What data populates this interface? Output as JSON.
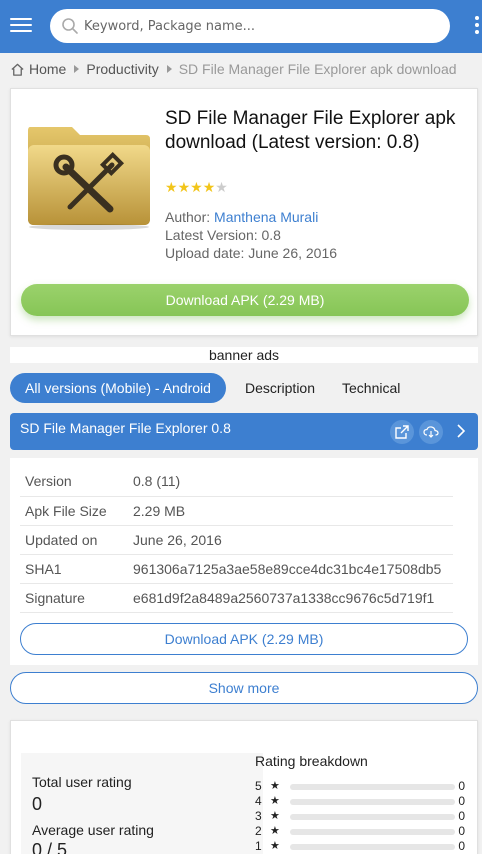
{
  "header": {
    "search_placeholder": "Keyword, Package name..."
  },
  "breadcrumb": {
    "home": "Home",
    "category": "Productivity",
    "current": "SD File Manager File Explorer apk download"
  },
  "app": {
    "title": "SD File Manager File Explorer apk download (Latest version: 0.8)",
    "rating_stars": 4,
    "max_stars": 5,
    "author_label": "Author:",
    "author_name": "Manthena Murali",
    "latest_version": "Latest Version: 0.8",
    "upload_date": "Upload date: June 26, 2016",
    "download_button": "Download APK (2.29 MB)"
  },
  "banner": "banner ads",
  "tabs": [
    {
      "label": "All versions (Mobile) - Android",
      "active": true
    },
    {
      "label": "Description",
      "active": false
    },
    {
      "label": "Technical",
      "active": false
    }
  ],
  "version_header": {
    "title": "SD File Manager File Explorer 0.8"
  },
  "details": {
    "rows": [
      {
        "key": "Version",
        "value": "0.8 (11)"
      },
      {
        "key": "Apk File Size",
        "value": "2.29 MB"
      },
      {
        "key": "Updated on",
        "value": "June 26, 2016"
      },
      {
        "key": "SHA1",
        "value": "961306a7125a3ae58e89cce4dc31bc4e17508db5"
      },
      {
        "key": "Signature",
        "value": "e681d9f2a8489a2560737a1338cc9676c5d719f1"
      }
    ],
    "download_button": "Download APK (2.29 MB)"
  },
  "show_more": "Show more",
  "rating": {
    "total_label": "Total user rating",
    "total_value": "0",
    "average_label": "Average user rating",
    "average_value": "0 / 5",
    "breakdown_title": "Rating breakdown",
    "breakdown": [
      {
        "stars": "5",
        "count": "0"
      },
      {
        "stars": "4",
        "count": "0"
      },
      {
        "stars": "3",
        "count": "0"
      },
      {
        "stars": "2",
        "count": "0"
      },
      {
        "stars": "1",
        "count": "0"
      }
    ]
  },
  "colors": {
    "primary": "#3d7fd0",
    "download_green": "#8ccb5c",
    "star": "#f2c51a"
  }
}
